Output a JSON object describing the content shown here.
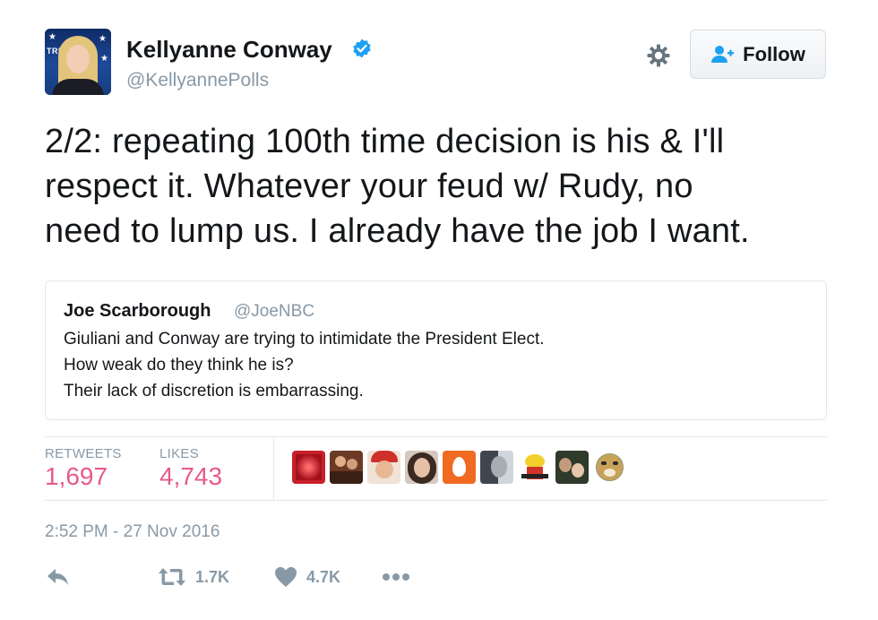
{
  "author": {
    "display_name": "Kellyanne Conway",
    "handle": "@KellyannePolls",
    "verified": true,
    "avatar_text": "TRU"
  },
  "header": {
    "settings_icon": "gear-icon",
    "follow_label": "Follow"
  },
  "tweet": {
    "lines": [
      "2/2: repeating 100th time decision is his & I'll",
      "respect it. Whatever your feud w/ Rudy, no",
      "need to lump us. I already have the job I want."
    ]
  },
  "quoted_tweet": {
    "name": "Joe Scarborough",
    "handle": "@JoeNBC",
    "lines": [
      "Giuliani and Conway are trying to intimidate the President Elect.",
      "How weak do they think he is?",
      "Their lack of discretion is embarrassing."
    ]
  },
  "stats": {
    "retweets_label": "RETWEETS",
    "retweets_value": "1,697",
    "likes_label": "LIKES",
    "likes_value": "4,743"
  },
  "likers": [
    {
      "name": "liker-avatar-1",
      "color": "#c8202a"
    },
    {
      "name": "liker-avatar-2",
      "color": "#6b3a24"
    },
    {
      "name": "liker-avatar-3",
      "color": "#c93a2b"
    },
    {
      "name": "liker-avatar-4",
      "color": "#3b2a22"
    },
    {
      "name": "liker-avatar-5",
      "color": "#f16a22"
    },
    {
      "name": "liker-avatar-6",
      "color": "#5a6370"
    },
    {
      "name": "liker-avatar-7",
      "color": "#ffffff"
    },
    {
      "name": "liker-avatar-8",
      "color": "#2e3a2a"
    },
    {
      "name": "liker-avatar-9",
      "color": "#8a9a72"
    }
  ],
  "timestamp": "2:52 PM - 27 Nov 2016",
  "actions": {
    "reply_icon": "reply-icon",
    "retweet_count": "1.7K",
    "like_count": "4.7K",
    "more_icon": "more-icon"
  },
  "colors": {
    "brand_blue": "#1da1f2",
    "muted": "#8899a6",
    "like_pink": "#e0245e",
    "border": "#e1e8ed"
  }
}
